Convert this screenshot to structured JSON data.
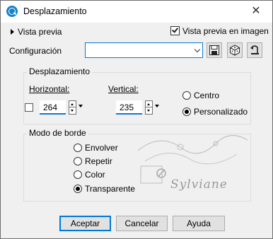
{
  "window": {
    "title": "Desplazamiento",
    "close_glyph": "✕",
    "icon": "app-icon"
  },
  "preview": {
    "toggle_label": "Vista previa",
    "checkbox_label": "Vista previa en imagen",
    "checkbox_checked": true
  },
  "configuration": {
    "label": "Configuración",
    "value": "",
    "buttons": [
      "save-preset-icon",
      "randomize-dice-icon",
      "reset-icon"
    ]
  },
  "displacement": {
    "group_title": "Desplazamiento",
    "horizontal_label": "Horizontal:",
    "horizontal_value": "264",
    "vertical_label": "Vertical:",
    "vertical_value": "235",
    "link_checkbox_checked": false,
    "center_label": "Centro",
    "custom_label": "Personalizado",
    "selected": "Personalizado"
  },
  "edge_mode": {
    "group_title": "Modo de borde",
    "options": [
      "Envolver",
      "Repetir",
      "Color",
      "Transparente"
    ],
    "selected": "Transparente"
  },
  "buttons": {
    "ok": "Aceptar",
    "cancel": "Cancelar",
    "help": "Ayuda"
  },
  "watermark_text": "Sylviane",
  "colors": {
    "accent": "#0078d7",
    "icon_blue": "#1584c8",
    "background": "#f0f0f0"
  }
}
